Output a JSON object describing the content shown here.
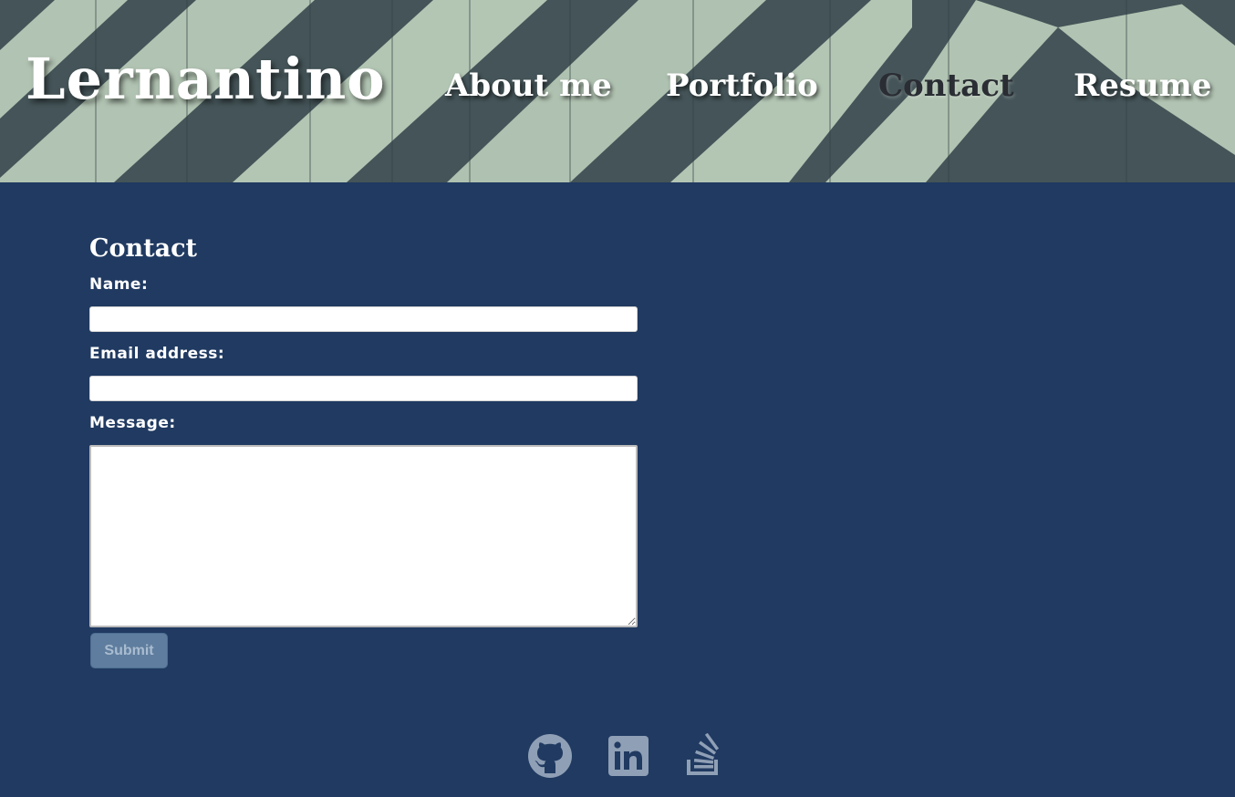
{
  "header": {
    "logo": "Lernantino",
    "nav": [
      {
        "label": "About me",
        "active": false
      },
      {
        "label": "Portfolio",
        "active": false
      },
      {
        "label": "Contact",
        "active": true
      },
      {
        "label": "Resume",
        "active": false
      }
    ]
  },
  "contact": {
    "title": "Contact",
    "name_label": "Name:",
    "name_value": "",
    "email_label": "Email address:",
    "email_value": "",
    "message_label": "Message:",
    "message_value": "",
    "submit_label": "Submit"
  },
  "footer": {
    "icons": [
      "github-icon",
      "linkedin-icon",
      "stack-overflow-icon"
    ]
  },
  "colors": {
    "page_background": "#203a61",
    "header_stripe_light": "#c9ddc7",
    "header_stripe_dark": "#4a5a5e",
    "submit_background": "#5f7d9e",
    "footer_icon": "#8f9fb5"
  }
}
